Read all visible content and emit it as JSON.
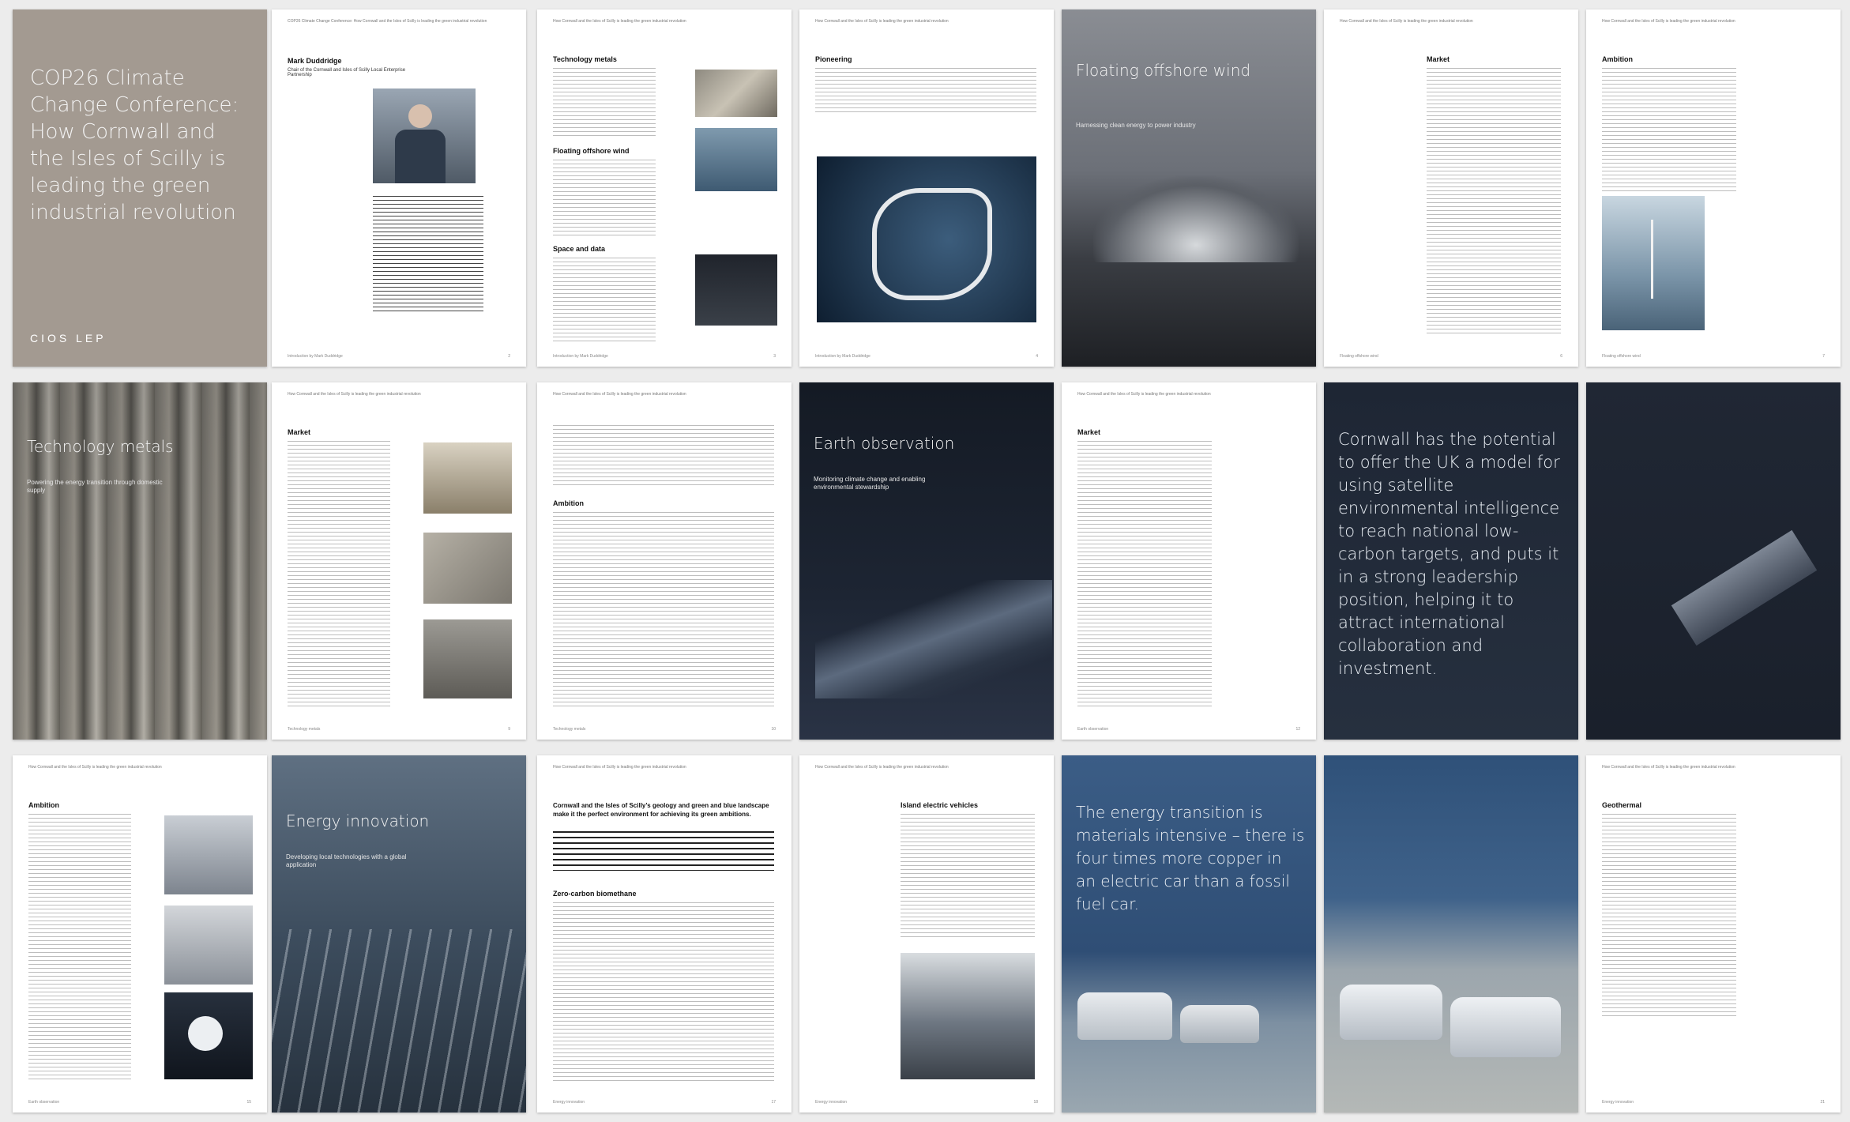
{
  "header_text": "How Cornwall and the Isles of Scilly is leading the green industrial revolution",
  "header_text_alt": "COP26 Climate Change Conference: How Cornwall and the Isles of Scilly is leading the green industrial revolution",
  "cover": {
    "title": "COP26 Climate Change Conference: How Cornwall and the Isles of Scilly is leading the green industrial revolution",
    "logo": "CIOS LEP"
  },
  "intro": {
    "name": "Mark Duddridge",
    "role": "Chair of the Cornwall and Isles of Scilly Local Enterprise Partnership",
    "footer": "Introduction by Mark Duddridge",
    "page": "2"
  },
  "page3": {
    "s1": "Technology metals",
    "s2": "Floating offshore wind",
    "s3": "Space and data",
    "footer": "Introduction by Mark Duddridge",
    "page": "3"
  },
  "page4": {
    "s1": "Pioneering",
    "footer": "Introduction by Mark Duddridge",
    "page": "4"
  },
  "wind": {
    "title": "Floating offshore wind",
    "subtitle": "Harnessing clean energy to power industry"
  },
  "page6": {
    "s1": "Market",
    "footer": "Floating offshore wind",
    "page": "6"
  },
  "page7": {
    "s1": "Ambition",
    "footer": "Floating offshore wind",
    "page": "7"
  },
  "metals": {
    "title": "Technology metals",
    "subtitle": "Powering the energy transition through domestic supply"
  },
  "page9": {
    "s1": "Market",
    "footer": "Technology metals",
    "page": "9"
  },
  "page10": {
    "s1": "Ambition",
    "footer": "Technology metals",
    "page": "10"
  },
  "earth": {
    "title": "Earth observation",
    "subtitle": "Monitoring climate change and enabling environmental stewardship"
  },
  "page12": {
    "s1": "Market",
    "footer": "Earth observation",
    "page": "12"
  },
  "quote1": {
    "text": "Cornwall has the potential to offer the UK a model for using satellite environmental intelligence to reach national low-carbon targets, and puts it in a strong leadership position, helping it to attract international collaboration and investment."
  },
  "page15": {
    "s1": "Ambition",
    "footer": "Earth observation",
    "page": "15"
  },
  "energy": {
    "title": "Energy innovation",
    "subtitle": "Developing local technologies with a global application"
  },
  "page17": {
    "intro": "Cornwall and the Isles of Scilly’s geology and green and blue landscape make it the perfect environment for achieving its green ambitions.",
    "s1": "Zero-carbon biomethane",
    "footer": "Energy innovation",
    "page": "17"
  },
  "page18": {
    "s1": "Island electric vehicles",
    "footer": "Energy innovation",
    "page": "18"
  },
  "quote2": {
    "text": "The energy transition is materials intensive – there is four times more copper in an electric car than a fossil fuel car."
  },
  "page21": {
    "s1": "Geothermal",
    "footer": "Energy innovation",
    "page": "21"
  },
  "colors": {
    "cover": "#a39a91",
    "navy": "#1a2230",
    "wind_sky": "#7b7f86"
  }
}
